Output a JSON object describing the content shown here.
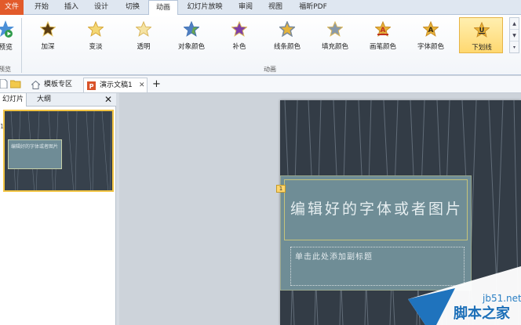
{
  "ribbon": {
    "tabs": [
      {
        "label": "文件"
      },
      {
        "label": "开始"
      },
      {
        "label": "插入"
      },
      {
        "label": "设计"
      },
      {
        "label": "切换"
      },
      {
        "label": "动画"
      },
      {
        "label": "幻灯片放映"
      },
      {
        "label": "审阅"
      },
      {
        "label": "视图"
      },
      {
        "label": "福昕PDF"
      }
    ],
    "preview_label": "预览",
    "preview_group_label": "预览",
    "effects": [
      {
        "label": "加深",
        "icon": "darken-star-icon",
        "color": "#6b4a14"
      },
      {
        "label": "变淡",
        "icon": "lighten-star-icon",
        "color": "#f3d36e"
      },
      {
        "label": "透明",
        "icon": "transparency-star-icon",
        "color": "#efd98a"
      },
      {
        "label": "对象颜色",
        "icon": "object-color-star-icon",
        "color": "#6aa84f"
      },
      {
        "label": "补色",
        "icon": "complementary-color-star-icon",
        "color": "#7e3fa8"
      },
      {
        "label": "线条颜色",
        "icon": "line-color-star-icon",
        "color": "#e6b43c"
      },
      {
        "label": "填充颜色",
        "icon": "fill-color-star-icon",
        "color": "#8899aa"
      },
      {
        "label": "画笔颜色",
        "icon": "brush-color-star-icon",
        "color": "#d8442e"
      },
      {
        "label": "字体颜色",
        "icon": "font-color-star-icon",
        "color": "#e8b43a"
      },
      {
        "label": "下划线",
        "icon": "underline-star-icon",
        "color": "#e8b43a"
      }
    ],
    "group_label": "动画"
  },
  "doc_tabs": {
    "template_tab": "模板专区",
    "active_doc": "演示文稿1",
    "add_symbol": "+",
    "close_symbol": "✕"
  },
  "left_panel": {
    "tab_slides": "幻灯片",
    "tab_outline": "大纲",
    "close_symbol": "✕",
    "slide_number": "1",
    "thumb_title": "编辑好的字体或者图片"
  },
  "slide": {
    "title": "编辑好的字体或者图片",
    "subtitle": "单击此处添加副标题",
    "anim_badge": "1"
  },
  "watermark": {
    "url": "jb51.net",
    "name": "脚本之家"
  }
}
